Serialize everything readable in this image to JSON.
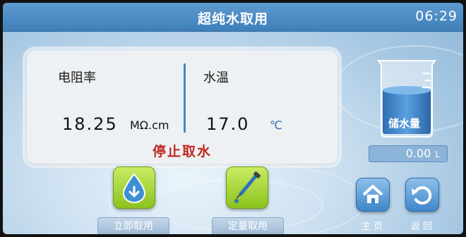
{
  "header": {
    "title": "超纯水取用",
    "time": "06:29"
  },
  "readings": {
    "resistivity_label": "电阻率",
    "resistivity_value": "18.25",
    "resistivity_unit": "MΩ.cm",
    "temperature_label": "水温",
    "temperature_value": "17.0",
    "temperature_unit": "℃",
    "status": "停止取水"
  },
  "tank": {
    "label": "储水量",
    "value": "0.00",
    "unit": "L"
  },
  "buttons": {
    "dispense_now": "立即取用",
    "quantitative": "定量取用",
    "home": "主 页",
    "back": "返 回"
  },
  "colors": {
    "accent": "#3f7fb9",
    "status": "#c0271f",
    "action_green": "#8cc31e"
  }
}
